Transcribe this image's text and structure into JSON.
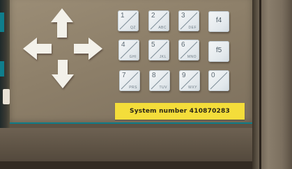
{
  "label": {
    "text": "System number 410870283"
  },
  "keys": [
    {
      "num": "1",
      "sub": "QZ"
    },
    {
      "num": "2",
      "sub": "ABC"
    },
    {
      "num": "3",
      "sub": "DEF"
    },
    {
      "num": "f4",
      "sub": ""
    },
    {
      "num": "4",
      "sub": "GHI"
    },
    {
      "num": "5",
      "sub": "JKL"
    },
    {
      "num": "6",
      "sub": "MNO"
    },
    {
      "num": "f5",
      "sub": ""
    },
    {
      "num": "7",
      "sub": "PRS"
    },
    {
      "num": "8",
      "sub": "TUV"
    },
    {
      "num": "9",
      "sub": "WXY"
    },
    {
      "num": "0",
      "sub": ""
    }
  ],
  "icons": [
    "arrow-up-icon",
    "arrow-left-icon",
    "arrow-right-icon",
    "arrow-down-icon"
  ],
  "colors": {
    "panel": "#8d7f69",
    "label": "#f4dd3a",
    "accent": "#0f7e8c",
    "key": "#e6ecef"
  }
}
